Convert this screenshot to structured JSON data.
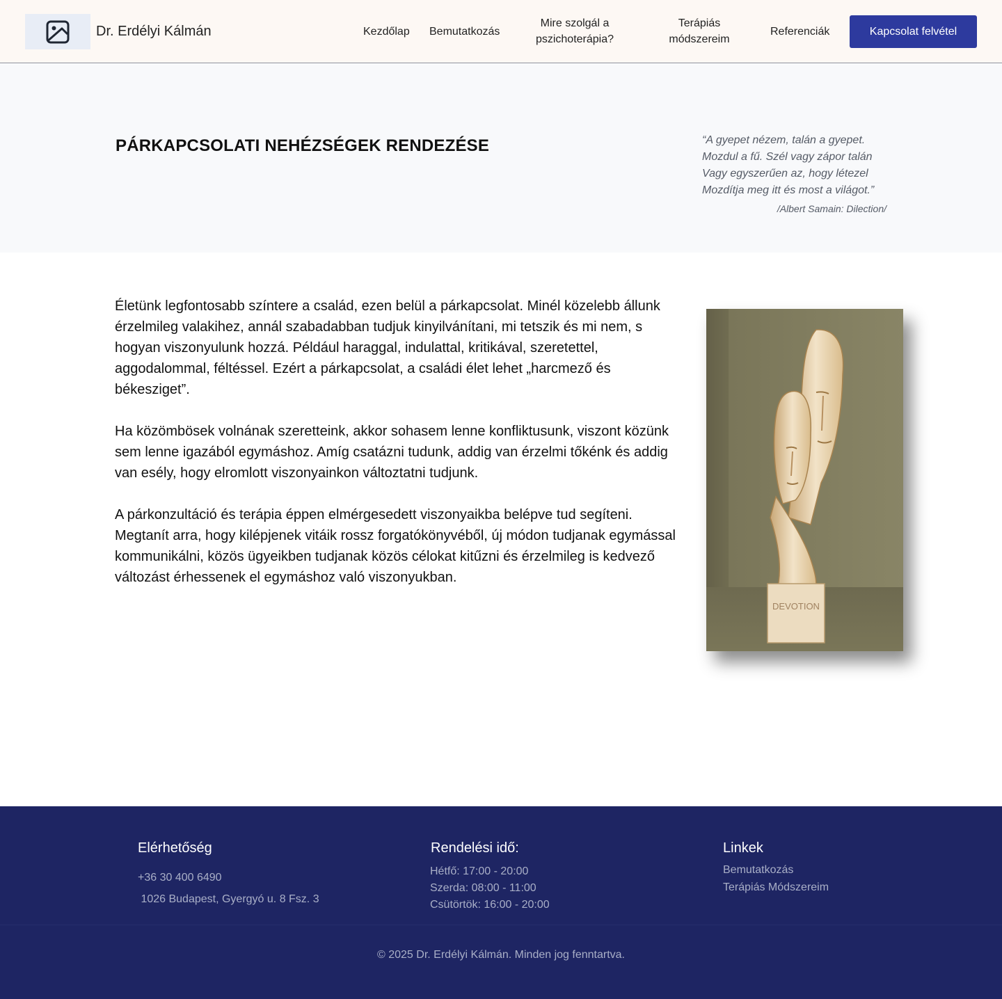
{
  "header": {
    "logo_icon": "image-placeholder-icon",
    "brand": "Dr. Erdélyi Kálmán",
    "nav": [
      {
        "label": "Kezdőlap"
      },
      {
        "label": "Bemutatkozás"
      },
      {
        "label_line1": "Mire szolgál a",
        "label_line2": "pszichoterápia?"
      },
      {
        "label_line1": "Terápiás",
        "label_line2": "módszereim"
      },
      {
        "label": "Referenciák"
      }
    ],
    "cta_label": "Kapcsolat felvétel"
  },
  "hero": {
    "title": "PÁRKAPCSOLATI NEHÉZSÉGEK RENDEZÉSE",
    "quote_lines": [
      "“A gyepet nézem, talán a gyepet.",
      "Mozdul a fű. Szél vagy zápor talán",
      "Vagy egyszerűen az, hogy létezel",
      "Mozdítja meg itt és most a világot.”"
    ],
    "quote_source": "/Albert Samain: Dilection/"
  },
  "main": {
    "paragraphs": [
      "Életünk legfontosabb színtere a család, ezen belül a párkapcsolat. Minél közelebb állunk érzelmileg valakihez, annál szabadabban tudjuk kinyilvánítani, mi tetszik és mi nem, s hogyan viszonyulunk hozzá. Például haraggal, indulattal, kritikával, szeretettel, aggodalommal, féltéssel. Ezért a párkapcsolat, a családi élet lehet „harcmező és békesziget”.",
      "Ha közömbösek volnának szeretteink, akkor sohasem lenne konfliktusunk, viszont közünk sem lenne igazából egymáshoz. Amíg csatázni tudunk, addig van érzelmi tőkénk és addig van esély, hogy elromlott viszonyainkon változtatni tudjunk.",
      "A párkonzultáció és terápia éppen elmérgesedett viszonyaikba belépve tud segíteni. Megtanít arra, hogy kilépjenek vitáik rossz forgatókönyvéből, új módon tudjanak egymással kommunikálni, közös ügyeikben tudjanak közös célokat kitűzni és érzelmileg is kedvező változást érhessenek el egymáshoz való viszonyukban."
    ],
    "photo_engraving": "DEVOTION"
  },
  "footer": {
    "contact_title": "Elérhetőség",
    "phone": "+36 30 400 6490",
    "address": " 1026 Budapest, Gyergyó u. 8 Fsz. 3",
    "hours_title": "Rendelési idő:",
    "hours": [
      "Hétfő: 17:00 - 20:00",
      "Szerda: 08:00 - 11:00",
      "Csütörtök: 16:00 - 20:00"
    ],
    "links_title": "Linkek",
    "links": [
      "Bemutatkozás",
      "Terápiás Módszereim"
    ],
    "copyright": "© 2025 Dr. Erdélyi Kálmán. Minden jog fenntartva."
  },
  "colors": {
    "header_bg": "#fdf8f4",
    "cta_bg": "#2d3a9e",
    "hero_bg": "#f8f9fb",
    "footer_bg": "#1e2563"
  }
}
